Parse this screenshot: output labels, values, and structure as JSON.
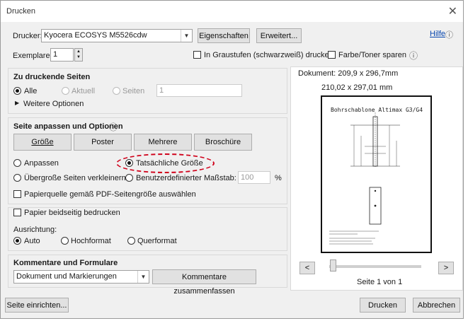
{
  "window": {
    "title": "Drucken"
  },
  "printer": {
    "label": "Drucker:",
    "value": "Kyocera ECOSYS M5526cdw",
    "properties_button": "Eigenschaften",
    "advanced_button": "Erweitert...",
    "help_link": "Hilfe"
  },
  "copies": {
    "label": "Exemplare:",
    "value": "1",
    "grayscale_label": "In Graustufen (schwarzweiß) drucken",
    "ink_save_label": "Farbe/Toner sparen"
  },
  "pages": {
    "title": "Zu druckende Seiten",
    "all": "Alle",
    "current": "Aktuell",
    "pages": "Seiten",
    "pages_value": "1",
    "more": "Weitere Optionen"
  },
  "sizing": {
    "title": "Seite anpassen und Optionen",
    "tabs": [
      "Größe",
      "Poster",
      "Mehrere",
      "Broschüre"
    ],
    "fit": "Anpassen",
    "actual_size": "Tatsächliche Größe",
    "shrink": "Übergroße Seiten verkleinern",
    "custom_scale": "Benutzerdefinierter Maßstab:",
    "scale_value": "100",
    "scale_unit": "%",
    "paper_source": "Papierquelle gemäß PDF-Seitengröße auswählen"
  },
  "duplex": {
    "label": "Papier beidseitig bedrucken",
    "orientation_label": "Ausrichtung:",
    "auto": "Auto",
    "portrait": "Hochformat",
    "landscape": "Querformat"
  },
  "comments": {
    "title": "Kommentare und Formulare",
    "value": "Dokument und Markierungen",
    "summarize_button": "Kommentare zusammenfassen"
  },
  "preview": {
    "document_size": "Dokument: 209,9 x 296,7mm",
    "paper_size": "210,02 x 297,01 mm",
    "page_title": "Bohrschablone Altimax G3/G4",
    "prev": "<",
    "next": ">",
    "page_indicator": "Seite 1 von 1"
  },
  "footer": {
    "page_setup": "Seite einrichten...",
    "print": "Drucken",
    "cancel": "Abbrechen"
  }
}
